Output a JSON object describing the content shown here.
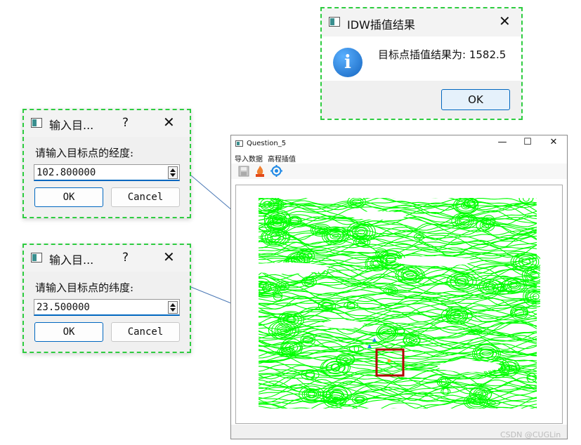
{
  "lon_dialog": {
    "title": "输入目...",
    "help": "?",
    "close": "✕",
    "prompt": "请输入目标点的经度:",
    "value": "102.800000",
    "ok_label": "OK",
    "cancel_label": "Cancel"
  },
  "lat_dialog": {
    "title": "输入目...",
    "help": "?",
    "close": "✕",
    "prompt": "请输入目标点的纬度:",
    "value": "23.500000",
    "ok_label": "OK",
    "cancel_label": "Cancel"
  },
  "result_dialog": {
    "title": "IDW插值结果",
    "close": "✕",
    "icon": "info-icon",
    "message": "目标点插值结果为: 1582.5",
    "ok_label": "OK"
  },
  "main_window": {
    "title": "Question_5",
    "minimize": "—",
    "maximize": "☐",
    "close": "✕",
    "menu": [
      "导入数据",
      "高程插值"
    ],
    "toolbar_icons": [
      "save-icon",
      "fire-icon",
      "target-icon"
    ],
    "map": {
      "contour_color": "#00ff00",
      "highlight_color": "#b30000",
      "marker_color": "#1e88e5",
      "point_color": "#f5a623"
    }
  },
  "watermark": "CSDN @CUGLin"
}
